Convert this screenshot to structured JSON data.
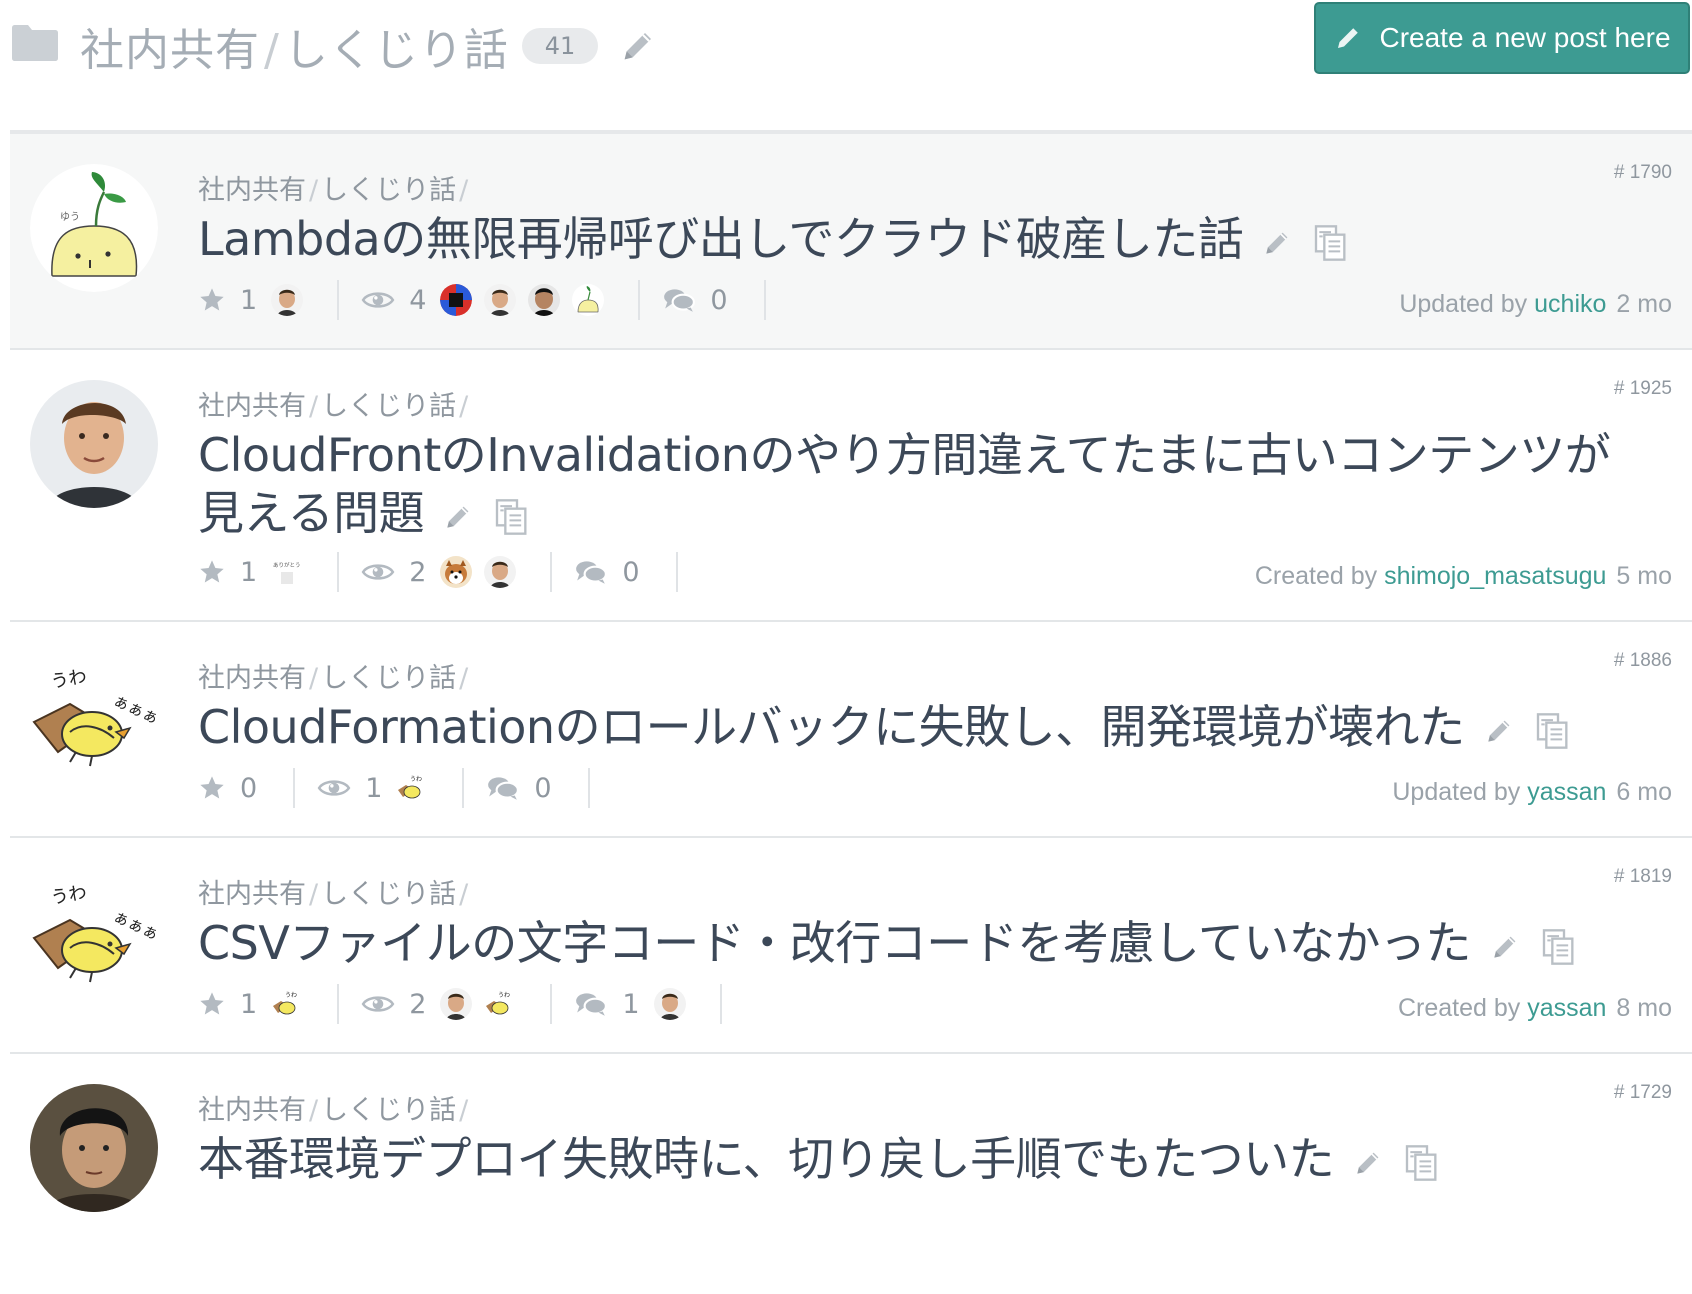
{
  "header": {
    "folder_root": "社内共有",
    "folder_name": "しくじり話",
    "separator": "/",
    "count": "41",
    "create_button_label": "Create a new post here"
  },
  "colors": {
    "accent": "#3d9b92",
    "text": "#3c4858",
    "muted": "#8f979f",
    "highlight_bg": "#f6f7f7"
  },
  "posts": [
    {
      "category_root": "社内共有",
      "category_name": "しくじり話",
      "number": "# 1790",
      "title": "Lambdaの無限再帰呼び出しでクラウド破産した話",
      "stars": "1",
      "watchers": "4",
      "comments": "0",
      "byline_prefix": "Updated by",
      "user": "uchiko",
      "time": "2 mo",
      "avatar_icon": "sprout-character-avatar"
    },
    {
      "category_root": "社内共有",
      "category_name": "しくじり話",
      "number": "# 1925",
      "title": "CloudFrontのInvalidationのやり方間違えてたまに古いコンテンツが見える問題",
      "stars": "1",
      "watchers": "2",
      "comments": "0",
      "byline_prefix": "Created by",
      "user": "shimojo_masatsugu",
      "time": "5 mo",
      "avatar_icon": "person-photo-avatar"
    },
    {
      "category_root": "社内共有",
      "category_name": "しくじり話",
      "number": "# 1886",
      "title": "CloudFormationのロールバックに失敗し、開発環境が壊れた",
      "stars": "0",
      "watchers": "1",
      "comments": "0",
      "byline_prefix": "Updated by",
      "user": "yassan",
      "time": "6 mo",
      "avatar_icon": "yellow-bird-avatar"
    },
    {
      "category_root": "社内共有",
      "category_name": "しくじり話",
      "number": "# 1819",
      "title": "CSVファイルの文字コード・改行コードを考慮していなかった",
      "stars": "1",
      "watchers": "2",
      "comments": "1",
      "byline_prefix": "Created by",
      "user": "yassan",
      "time": "8 mo",
      "avatar_icon": "yellow-bird-avatar"
    },
    {
      "category_root": "社内共有",
      "category_name": "しくじり話",
      "number": "# 1729",
      "title": "本番環境デプロイ失敗時に、切り戻し手順でもたついた",
      "avatar_icon": "person-photo-avatar"
    }
  ]
}
